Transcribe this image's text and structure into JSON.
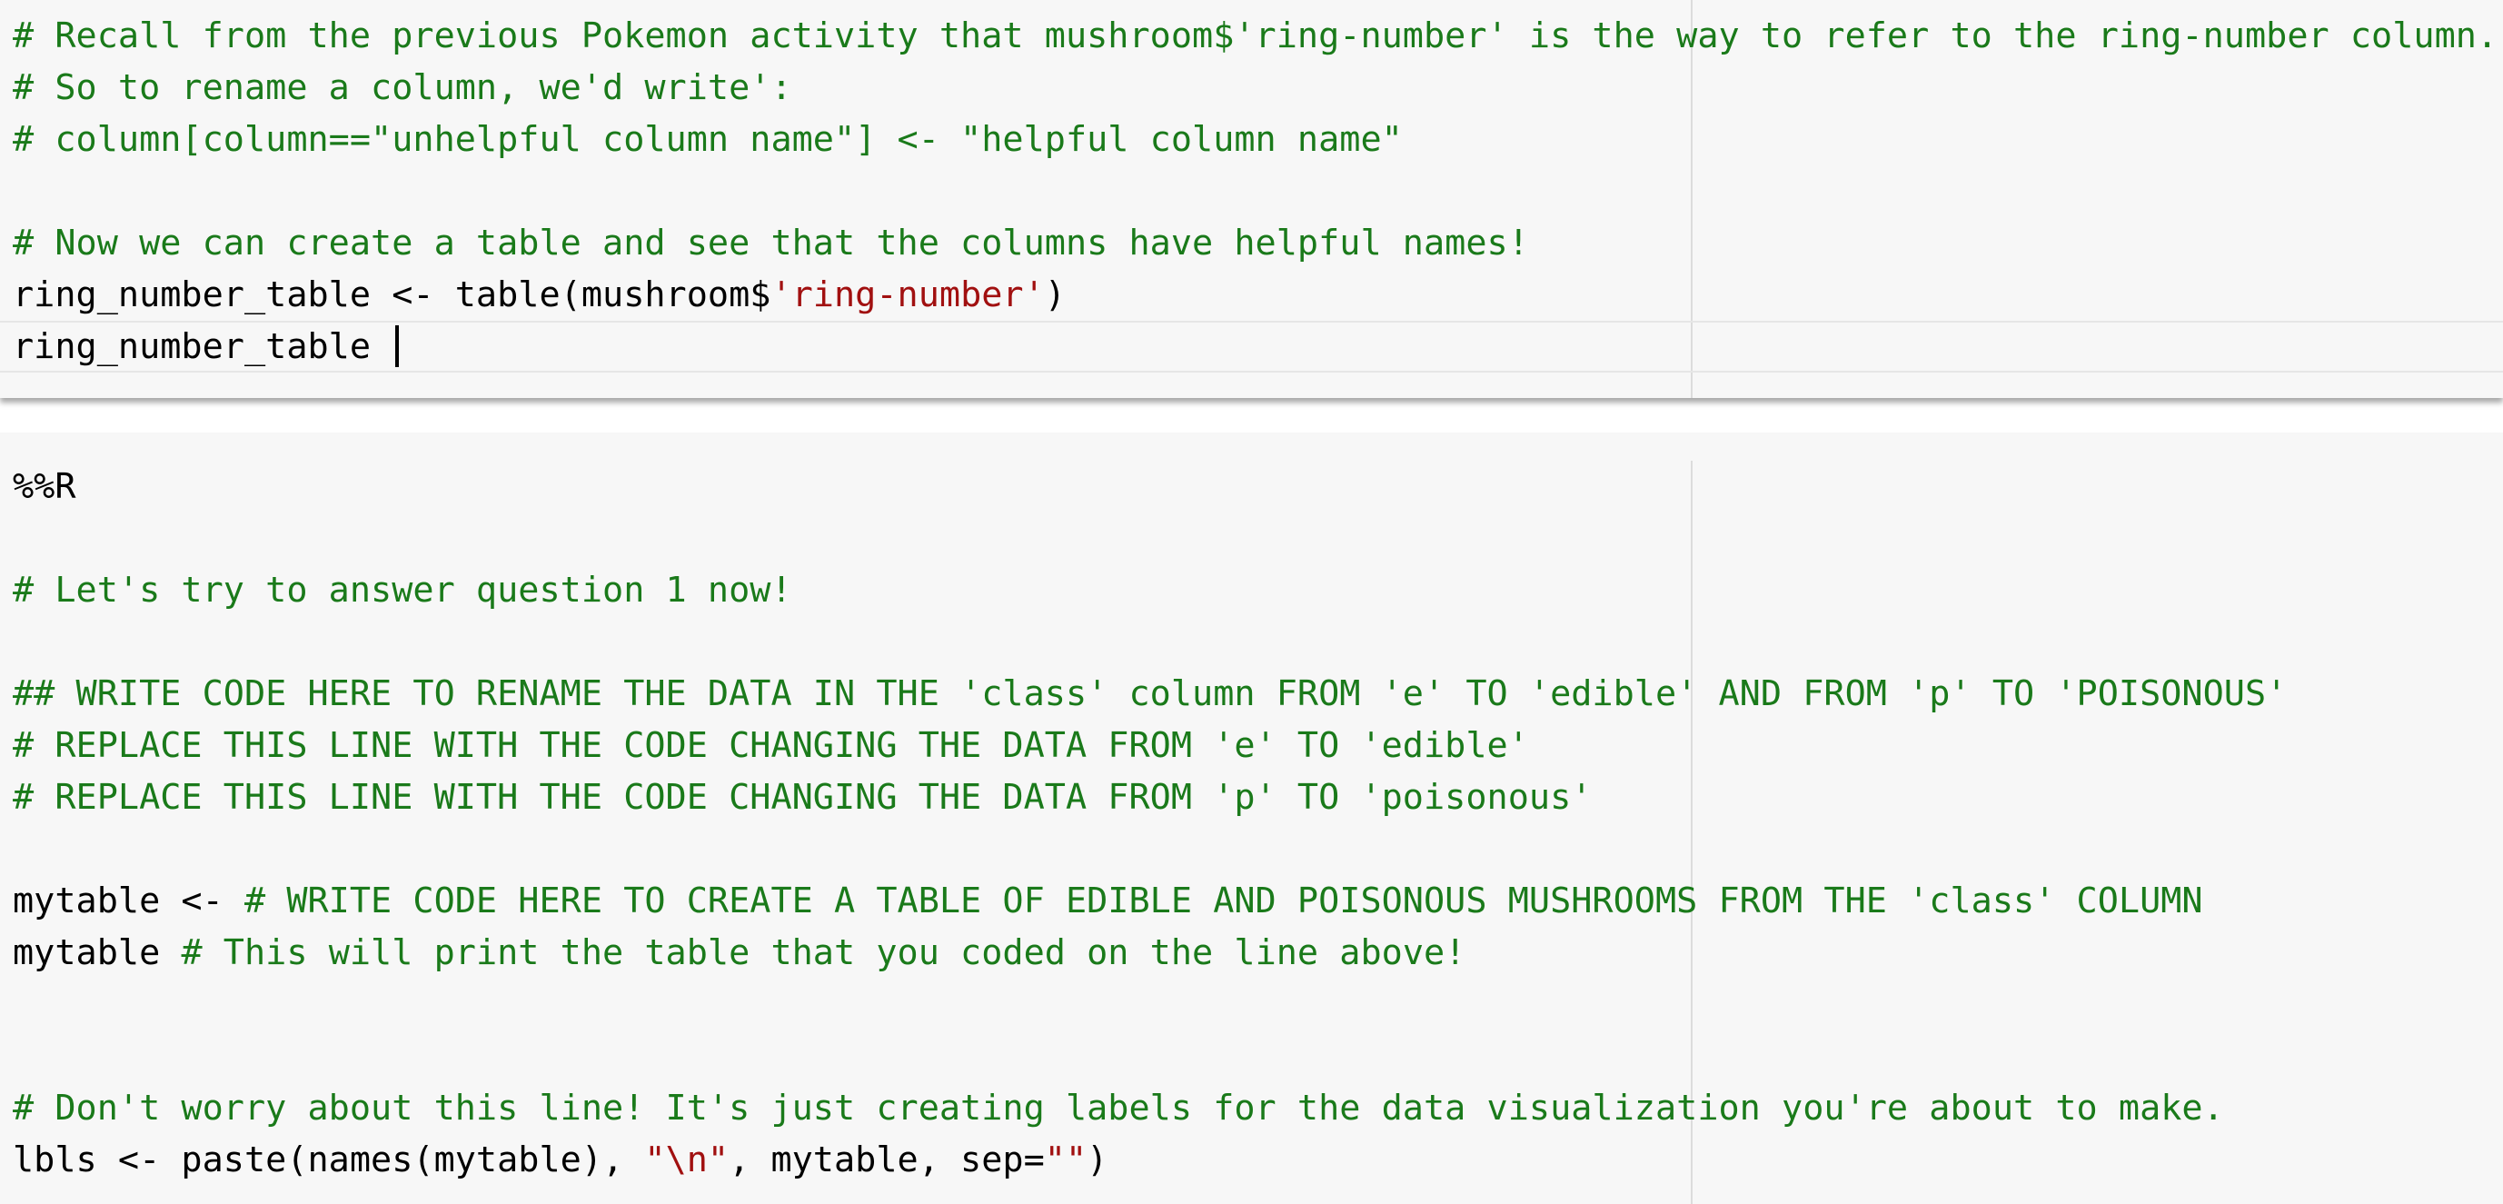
{
  "top_cell": {
    "lines": [
      {
        "comment": "# Recall from the previous Pokemon activity that mushroom$'ring-number' is the way to refer to the ring-number column."
      },
      {
        "comment": "# So to rename a column, we'd write':"
      },
      {
        "comment": "# column[column==\"unhelpful column name\"] <- \"helpful column name\""
      },
      {
        "comment": ""
      },
      {
        "comment": "# Now we can create a table and see that the columns have helpful names!"
      },
      {
        "code_before": "ring_number_table <- table(mushroom$",
        "string": "'ring-number'",
        "code_after": ")"
      },
      {
        "code": "ring_number_table "
      }
    ]
  },
  "bottom_cell": {
    "lines": [
      {
        "code": "%%R"
      },
      {
        "comment": ""
      },
      {
        "comment": "# Let's try to answer question 1 now!"
      },
      {
        "comment": ""
      },
      {
        "comment": "## WRITE CODE HERE TO RENAME THE DATA IN THE 'class' column FROM 'e' TO 'edible' AND FROM 'p' TO 'POISONOUS'"
      },
      {
        "comment": "# REPLACE THIS LINE WITH THE CODE CHANGING THE DATA FROM 'e' TO 'edible'"
      },
      {
        "comment": "# REPLACE THIS LINE WITH THE CODE CHANGING THE DATA FROM 'p' TO 'poisonous'"
      },
      {
        "comment": ""
      },
      {
        "code": "mytable <- ",
        "comment": "# WRITE CODE HERE TO CREATE A TABLE OF EDIBLE AND POISONOUS MUSHROOMS FROM THE 'class' COLUMN"
      },
      {
        "code": "mytable ",
        "comment": "# This will print the table that you coded on the line above!"
      },
      {
        "comment": ""
      },
      {
        "comment": ""
      },
      {
        "comment": "# Don't worry about this line! It's just creating labels for the data visualization you're about to make."
      },
      {
        "code_before": "lbls <- paste(names(mytable), ",
        "string": "\"\\n\"",
        "code_middle": ", mytable, sep=",
        "string2": "\"\"",
        "code_after": ")"
      }
    ]
  },
  "colors": {
    "comment": "#1a7a1a",
    "string": "#a11010",
    "code": "#000000",
    "cell_background": "#f7f7f7"
  }
}
